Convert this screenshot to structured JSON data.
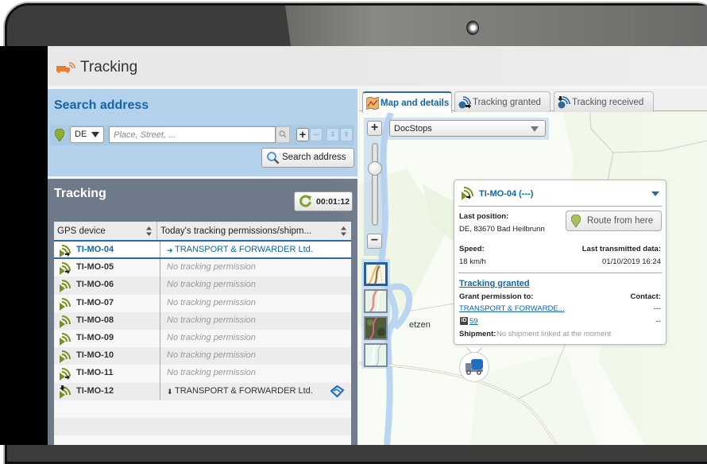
{
  "app": {
    "title": "Tracking",
    "icon": "truck-signal-icon",
    "brand_color": "#f07c2e",
    "accent_color": "#1066aa"
  },
  "search": {
    "title": "Search address",
    "country": "DE",
    "place_placeholder": "Place, Street, ...",
    "place_value": "",
    "search_button_label": "Search address"
  },
  "tracking": {
    "title": "Tracking",
    "refresh_timer": "00:01:12",
    "columns": [
      "GPS device",
      "Today's tracking permissions/shipm..."
    ],
    "rows": [
      {
        "device": "TI-MO-04",
        "permission": "TRANSPORT & FORWARDER Ltd.",
        "direction": "outgoing",
        "selected": true
      },
      {
        "device": "TI-MO-05",
        "permission": "No tracking permission",
        "direction": "outgoing",
        "selected": false
      },
      {
        "device": "TI-MO-06",
        "permission": "No tracking permission",
        "direction": "none",
        "selected": false
      },
      {
        "device": "TI-MO-07",
        "permission": "No tracking permission",
        "direction": "none",
        "selected": false
      },
      {
        "device": "TI-MO-08",
        "permission": "No tracking permission",
        "direction": "none",
        "selected": false
      },
      {
        "device": "TI-MO-09",
        "permission": "No tracking permission",
        "direction": "none",
        "selected": false
      },
      {
        "device": "TI-MO-10",
        "permission": "No tracking permission",
        "direction": "none",
        "selected": false
      },
      {
        "device": "TI-MO-11",
        "permission": "No tracking permission",
        "direction": "outgoing",
        "selected": false
      },
      {
        "device": "TI-MO-12",
        "permission": "TRANSPORT & FORWARDER Ltd.",
        "direction": "incoming",
        "selected": false,
        "handshake": true
      }
    ]
  },
  "map": {
    "tabs": [
      {
        "label": "Map and details",
        "icon": "map-icon",
        "active": true
      },
      {
        "label": "Tracking granted",
        "icon": "tracking-granted-icon",
        "active": false
      },
      {
        "label": "Tracking received",
        "icon": "tracking-received-icon",
        "active": false
      }
    ],
    "layer": "DocStops",
    "zoom_level_fraction": 0.27,
    "map_types": [
      "standard",
      "topographic",
      "satellite",
      "light"
    ],
    "place_label": "etzen"
  },
  "popup": {
    "title": "TI-MO-04 (---)",
    "last_position_label": "Last position:",
    "last_position": "DE, 83670 Bad Heilbrunn",
    "route_button": "Route from here",
    "speed_label": "Speed:",
    "speed": "18 km/h",
    "last_data_label": "Last transmitted data:",
    "last_data": "01/10/2019 16:24",
    "status_link": "Tracking granted",
    "grant_label": "Grant permission to:",
    "contact_label": "Contact:",
    "grant_company": "TRANSPORT & FORWARDE...",
    "contact_value_1": "---",
    "id_value": "59",
    "contact_value_2": "--",
    "shipment_label": "Shipment:",
    "shipment_value": "No shipment linked at the moment"
  }
}
